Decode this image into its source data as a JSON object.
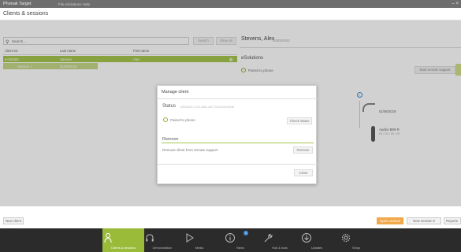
{
  "titlebar": {
    "app_name": "Phonak Target",
    "subtitle": "File   eSolutions   Help",
    "window_controls": "– ×"
  },
  "page": {
    "title": "Clients & sessions"
  },
  "search": {
    "placeholder": "Search...",
    "search_button": "Search",
    "show_all_button": "Show all"
  },
  "table": {
    "columns": [
      "Client ID",
      "Last name",
      "First name"
    ],
    "selected_row": {
      "client_id": "▾ 000000",
      "last_name": "Stevens",
      "first_name": "Alex"
    },
    "session_row": {
      "label": "Session 1",
      "value": "01/06/2019"
    }
  },
  "client_panel": {
    "name": "Stevens, Alex",
    "id": "000000000",
    "section_title": "eSolutions",
    "paired_text": "Paired to phone",
    "remote_button": "Start remote support",
    "device1_label": "01/06/2019",
    "device2_label": "Audéo B90-R",
    "device2_sub": "00 / 00 / 00 / 00"
  },
  "modal": {
    "title": "Manage client",
    "status_label": "Status",
    "status_value": "b9f3a4e8-c7d0-4b6e-a3f7-0e2d1a9c5b48",
    "paired_text": "Paired to phone",
    "check_status_button": "Check status",
    "remove_label": "Remove",
    "remove_desc": "Remove client from remote support",
    "remove_button": "Remove",
    "close_button": "Close"
  },
  "footer": {
    "new_client_button": "New client",
    "open_session_button": "Open session",
    "new_session_button": "New session",
    "report_button": "Reports"
  },
  "navbar": {
    "items": [
      {
        "label": "Clients & sessions"
      },
      {
        "label": "Demonstration"
      },
      {
        "label": "Media"
      },
      {
        "label": "News"
      },
      {
        "label": "Hub & tools"
      },
      {
        "label": "Updates"
      },
      {
        "label": "Setup"
      }
    ],
    "news_badge": "1"
  },
  "colors": {
    "accent_green": "#9abb3a",
    "row_selected": "#a7c64d",
    "orange_button": "#f0a84a",
    "info_blue": "#3c8fd6"
  }
}
